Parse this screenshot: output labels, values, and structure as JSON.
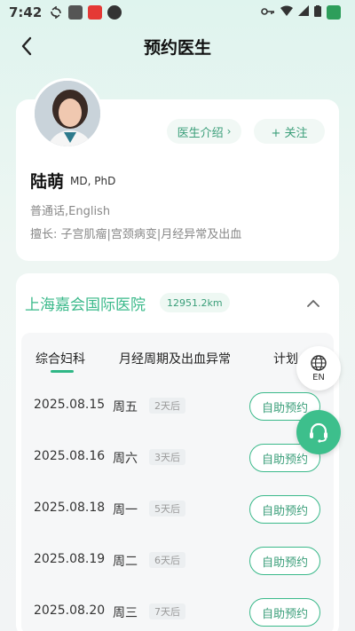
{
  "status_bar": {
    "time": "7:42"
  },
  "header": {
    "title": "预约医生"
  },
  "doctor": {
    "intro_button": "医生介绍",
    "follow_button": "+ 关注",
    "name": "陆萌",
    "degree": "MD, PhD",
    "languages": "普通话,English",
    "specialty": "擅长: 子宫肌瘤|宫颈病变|月经异常及出血"
  },
  "hospital": {
    "name": "上海嘉会国际医院",
    "distance": "12951.2km"
  },
  "tabs": [
    "综合妇科",
    "月经周期及出血异常",
    "计划"
  ],
  "schedule": [
    {
      "date": "2025.08.15",
      "weekday": "周五",
      "days_after": "2天后",
      "button": "自助预约"
    },
    {
      "date": "2025.08.16",
      "weekday": "周六",
      "days_after": "3天后",
      "button": "自助预约"
    },
    {
      "date": "2025.08.18",
      "weekday": "周一",
      "days_after": "5天后",
      "button": "自助预约"
    },
    {
      "date": "2025.08.19",
      "weekday": "周二",
      "days_after": "6天后",
      "button": "自助预约"
    },
    {
      "date": "2025.08.20",
      "weekday": "周三",
      "days_after": "7天后",
      "button": "自助预约"
    }
  ],
  "floating": {
    "lang_label": "EN"
  },
  "colors": {
    "accent": "#3ab98a",
    "background_top": "#dff4ee"
  },
  "icons": {
    "back": "chevron-left-icon",
    "collapse": "chevron-up-icon",
    "lang": "globe-icon",
    "support": "headset-icon"
  }
}
